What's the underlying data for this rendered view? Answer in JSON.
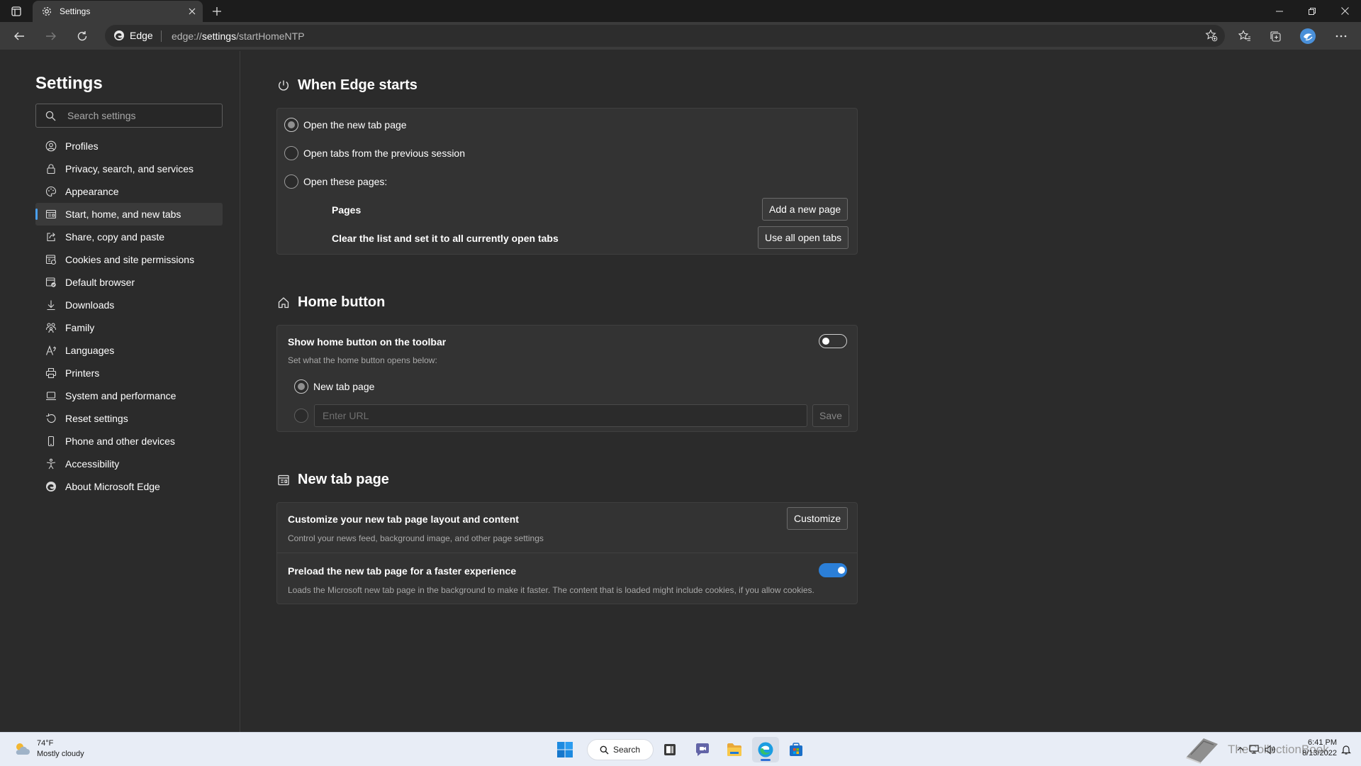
{
  "tab": {
    "title": "Settings"
  },
  "toolbar": {
    "identity_label": "Edge",
    "url_scheme": "edge://",
    "url_host": "settings",
    "url_path": "/startHomeNTP"
  },
  "sidebar": {
    "title": "Settings",
    "search_placeholder": "Search settings",
    "items": [
      {
        "label": "Profiles",
        "icon": "profile-icon",
        "active": false
      },
      {
        "label": "Privacy, search, and services",
        "icon": "lock-icon",
        "active": false
      },
      {
        "label": "Appearance",
        "icon": "palette-icon",
        "active": false
      },
      {
        "label": "Start, home, and new tabs",
        "icon": "start-page-icon",
        "active": true
      },
      {
        "label": "Share, copy and paste",
        "icon": "share-icon",
        "active": false
      },
      {
        "label": "Cookies and site permissions",
        "icon": "cookies-icon",
        "active": false
      },
      {
        "label": "Default browser",
        "icon": "browser-icon",
        "active": false
      },
      {
        "label": "Downloads",
        "icon": "download-icon",
        "active": false
      },
      {
        "label": "Family",
        "icon": "family-icon",
        "active": false
      },
      {
        "label": "Languages",
        "icon": "language-icon",
        "active": false
      },
      {
        "label": "Printers",
        "icon": "printer-icon",
        "active": false
      },
      {
        "label": "System and performance",
        "icon": "laptop-icon",
        "active": false
      },
      {
        "label": "Reset settings",
        "icon": "reset-icon",
        "active": false
      },
      {
        "label": "Phone and other devices",
        "icon": "phone-icon",
        "active": false
      },
      {
        "label": "Accessibility",
        "icon": "accessibility-icon",
        "active": false
      },
      {
        "label": "About Microsoft Edge",
        "icon": "edge-logo-icon",
        "active": false
      }
    ]
  },
  "when_edge_starts": {
    "title": "When Edge starts",
    "option_new_tab": "Open the new tab page",
    "option_previous": "Open tabs from the previous session",
    "option_pages": "Open these pages:",
    "selected": "option_new_tab",
    "pages_label": "Pages",
    "add_page_button": "Add a new page",
    "clear_list_label": "Clear the list and set it to all currently open tabs",
    "use_all_tabs_button": "Use all open tabs"
  },
  "home_button": {
    "title": "Home button",
    "show_label": "Show home button on the toolbar",
    "show_enabled": false,
    "description": "Set what the home button opens below:",
    "option_new_tab": "New tab page",
    "url_placeholder": "Enter URL",
    "save_button": "Save"
  },
  "new_tab_page": {
    "title": "New tab page",
    "customize_label": "Customize your new tab page layout and content",
    "customize_desc": "Control your news feed, background image, and other page settings",
    "customize_button": "Customize",
    "preload_label": "Preload the new tab page for a faster experience",
    "preload_desc": "Loads the Microsoft new tab page in the background to make it faster. The content that is loaded might include cookies, if you allow cookies.",
    "preload_enabled": true
  },
  "taskbar": {
    "weather_temp": "74°F",
    "weather_desc": "Mostly cloudy",
    "search_label": "Search",
    "watermark": "TheCollectionBook",
    "time": "6:41 PM",
    "date": "8/13/2022"
  },
  "colors": {
    "accent": "#2b7fd8",
    "nav_active_indicator": "#4aa0f0",
    "page_background": "#2b2b2b",
    "card_background": "#333333",
    "taskbar_background": "#e8edf6"
  }
}
